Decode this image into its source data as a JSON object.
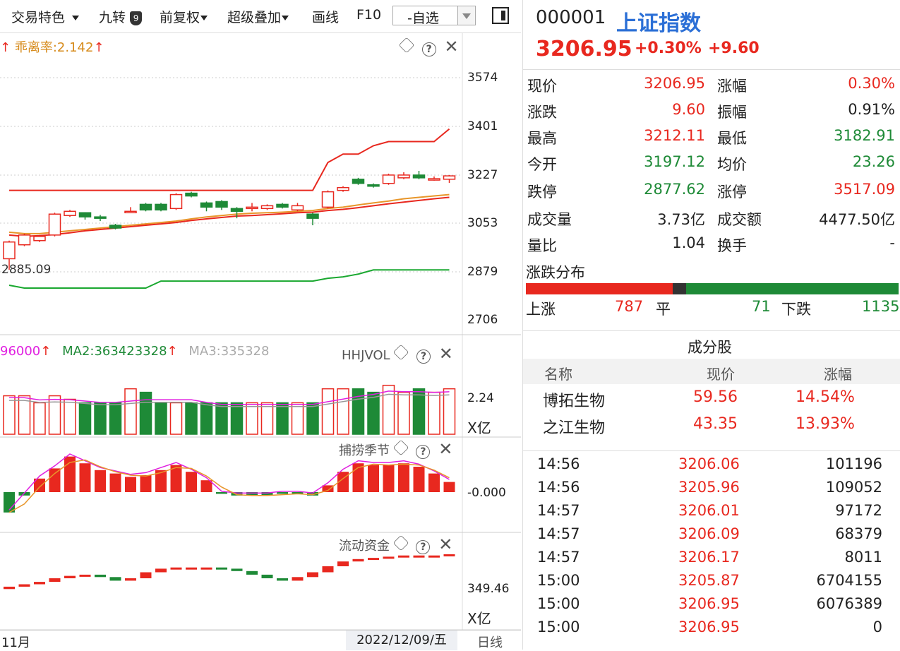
{
  "toolbar": {
    "trade_feature": "交易特色",
    "jiuzhuan": "九转",
    "jiuzhuan_badge": "9",
    "fuquan": "前复权",
    "overlay": "超级叠加",
    "draw": "画线",
    "f10": "F10",
    "zixuan": "-自选"
  },
  "main_panel": {
    "indicator": "乖离率:2.142",
    "y_labels": [
      "3574",
      "3401",
      "3227",
      "3053",
      "2879",
      "2706"
    ],
    "low_label": "2885.09"
  },
  "vol_panel": {
    "ma1": "96000",
    "ma2": "MA2:363423328",
    "ma3": "MA3:335328",
    "name": "HHJVOL",
    "y_label": "2.24",
    "unit": "X亿"
  },
  "season_panel": {
    "name": "捕捞季节",
    "y_label": "-0.000"
  },
  "flow_panel": {
    "name": "流动资金",
    "y_label": "349.46",
    "unit": "X亿"
  },
  "bottom": {
    "month": "11月",
    "date": "2022/12/09/五",
    "period": "日线"
  },
  "quote": {
    "code": "000001",
    "name": "上证指数",
    "price": "3206.95",
    "pct": "+0.30%",
    "chg": "+9.60",
    "rows": [
      {
        "l1": "现价",
        "v1": "3206.95",
        "l2": "涨幅",
        "v2": "0.30%"
      },
      {
        "l1": "涨跌",
        "v1": "9.60",
        "l2": "振幅",
        "v2": "0.91%"
      },
      {
        "l1": "最高",
        "v1": "3212.11",
        "l2": "最低",
        "v2": "3182.91"
      },
      {
        "l1": "今开",
        "v1": "3197.12",
        "l2": "均价",
        "v2": "23.26"
      },
      {
        "l1": "跌停",
        "v1": "2877.62",
        "l2": "涨停",
        "v2": "3517.09"
      },
      {
        "l1": "成交量",
        "v1": "3.73亿",
        "l2": "成交额",
        "v2": "4477.50亿"
      },
      {
        "l1": "量比",
        "v1": "1.04",
        "l2": "换手",
        "v2": "-"
      }
    ],
    "dist_title": "涨跌分布",
    "up_label": "上涨",
    "up": "787",
    "flat_label": "平",
    "flat": "71",
    "down_label": "下跌",
    "down": "1135"
  },
  "components": {
    "title": "成分股",
    "headers": [
      "名称",
      "现价",
      "涨幅"
    ],
    "rows": [
      {
        "name": "博拓生物",
        "price": "59.56",
        "pct": "14.54%"
      },
      {
        "name": "之江生物",
        "price": "43.35",
        "pct": "13.93%"
      }
    ]
  },
  "ticks": [
    {
      "time": "14:56",
      "price": "3206.06",
      "vol": "101196"
    },
    {
      "time": "14:56",
      "price": "3205.96",
      "vol": "109052"
    },
    {
      "time": "14:57",
      "price": "3206.01",
      "vol": "97172"
    },
    {
      "time": "14:57",
      "price": "3206.09",
      "vol": "68379"
    },
    {
      "time": "14:57",
      "price": "3206.17",
      "vol": "8011"
    },
    {
      "time": "15:00",
      "price": "3205.87",
      "vol": "6704155"
    },
    {
      "time": "15:00",
      "price": "3206.95",
      "vol": "6076389"
    },
    {
      "time": "15:00",
      "price": "3206.95",
      "vol": "0"
    }
  ],
  "colors": {
    "up": "#e8281f",
    "down": "#1e8a37",
    "link": "#2b6fd6",
    "ma_orange": "#e8962a",
    "ma_magenta": "#e020e0"
  },
  "chart_data": {
    "type": "candlestick",
    "candles": [
      {
        "o": 2925,
        "c": 2985,
        "h": 2990,
        "l": 2885
      },
      {
        "o": 2975,
        "c": 3010,
        "h": 3015,
        "l": 2970
      },
      {
        "o": 2990,
        "c": 3005,
        "h": 3010,
        "l": 2985
      },
      {
        "o": 3010,
        "c": 3085,
        "h": 3090,
        "l": 3005
      },
      {
        "o": 3080,
        "c": 3095,
        "h": 3100,
        "l": 3075
      },
      {
        "o": 3090,
        "c": 3075,
        "h": 3092,
        "l": 3065
      },
      {
        "o": 3075,
        "c": 3070,
        "h": 3082,
        "l": 3060
      },
      {
        "o": 3045,
        "c": 3035,
        "h": 3050,
        "l": 3030
      },
      {
        "o": 3095,
        "c": 3095,
        "h": 3110,
        "l": 3090
      },
      {
        "o": 3120,
        "c": 3100,
        "h": 3125,
        "l": 3095
      },
      {
        "o": 3120,
        "c": 3100,
        "h": 3125,
        "l": 3095
      },
      {
        "o": 3105,
        "c": 3155,
        "h": 3160,
        "l": 3100
      },
      {
        "o": 3160,
        "c": 3150,
        "h": 3165,
        "l": 3145
      },
      {
        "o": 3125,
        "c": 3110,
        "h": 3130,
        "l": 3095
      },
      {
        "o": 3130,
        "c": 3110,
        "h": 3135,
        "l": 3100
      },
      {
        "o": 3105,
        "c": 3095,
        "h": 3110,
        "l": 3070
      },
      {
        "o": 3110,
        "c": 3110,
        "h": 3125,
        "l": 3095
      },
      {
        "o": 3105,
        "c": 3115,
        "h": 3120,
        "l": 3100
      },
      {
        "o": 3120,
        "c": 3110,
        "h": 3125,
        "l": 3105
      },
      {
        "o": 3100,
        "c": 3115,
        "h": 3125,
        "l": 3095
      },
      {
        "o": 3085,
        "c": 3070,
        "h": 3090,
        "l": 3045
      },
      {
        "o": 3110,
        "c": 3165,
        "h": 3170,
        "l": 3105
      },
      {
        "o": 3170,
        "c": 3180,
        "h": 3185,
        "l": 3165
      },
      {
        "o": 3210,
        "c": 3195,
        "h": 3215,
        "l": 3190
      },
      {
        "o": 3190,
        "c": 3185,
        "h": 3195,
        "l": 3180
      },
      {
        "o": 3195,
        "c": 3225,
        "h": 3230,
        "l": 3190
      },
      {
        "o": 3215,
        "c": 3225,
        "h": 3235,
        "l": 3210
      },
      {
        "o": 3225,
        "c": 3215,
        "h": 3240,
        "l": 3210
      },
      {
        "o": 3210,
        "c": 3212,
        "h": 3220,
        "l": 3205
      },
      {
        "o": 3210,
        "c": 3222,
        "h": 3225,
        "l": 3197
      }
    ],
    "upper_band": [
      3170,
      3170,
      3170,
      3170,
      3170,
      3170,
      3170,
      3170,
      3170,
      3170,
      3170,
      3170,
      3170,
      3170,
      3170,
      3170,
      3170,
      3170,
      3170,
      3170,
      3170,
      3270,
      3300,
      3300,
      3330,
      3345,
      3345,
      3345,
      3345,
      3390
    ],
    "lower_band": [
      2830,
      2820,
      2820,
      2820,
      2820,
      2820,
      2820,
      2820,
      2820,
      2820,
      2845,
      2845,
      2845,
      2845,
      2845,
      2845,
      2845,
      2845,
      2845,
      2845,
      2845,
      2855,
      2860,
      2870,
      2885,
      2885,
      2885,
      2885,
      2885,
      2885
    ],
    "ma_a": [
      3020,
      3015,
      3015,
      3020,
      3025,
      3030,
      3035,
      3040,
      3045,
      3050,
      3055,
      3060,
      3068,
      3075,
      3080,
      3085,
      3088,
      3090,
      3092,
      3095,
      3098,
      3105,
      3110,
      3118,
      3125,
      3132,
      3140,
      3145,
      3150,
      3155
    ],
    "ma_b": [
      3010,
      3005,
      3008,
      3012,
      3018,
      3025,
      3030,
      3035,
      3040,
      3045,
      3050,
      3055,
      3062,
      3068,
      3073,
      3078,
      3080,
      3083,
      3086,
      3090,
      3092,
      3098,
      3102,
      3108,
      3115,
      3122,
      3128,
      3134,
      3140,
      3145
    ],
    "volume": [
      0.55,
      0.55,
      0.45,
      0.55,
      0.5,
      0.45,
      0.45,
      0.45,
      0.65,
      0.6,
      0.45,
      0.45,
      0.45,
      0.45,
      0.45,
      0.45,
      0.45,
      0.45,
      0.45,
      0.45,
      0.45,
      0.65,
      0.65,
      0.65,
      0.6,
      0.7,
      0.6,
      0.65,
      0.6,
      0.65
    ],
    "season_bars": [
      -1.2,
      -0.2,
      0.8,
      1.4,
      2.1,
      1.7,
      1.3,
      1.1,
      0.9,
      1.0,
      1.3,
      1.6,
      1.2,
      0.7,
      -0.1,
      -0.2,
      -0.2,
      -0.2,
      -0.1,
      -0.1,
      -0.2,
      0.4,
      1.2,
      1.7,
      1.6,
      1.6,
      1.7,
      1.5,
      1.1,
      0.6
    ],
    "flow_bars": [
      0.3,
      0.5,
      0.7,
      1.0,
      1.2,
      1.3,
      1.1,
      0.8,
      1.0,
      1.5,
      1.8,
      1.9,
      1.9,
      1.9,
      1.8,
      1.6,
      1.3,
      1.0,
      0.8,
      1.1,
      1.5,
      2.0,
      2.4,
      2.6,
      2.7,
      2.8,
      2.9,
      2.9,
      2.9,
      3.0
    ]
  }
}
